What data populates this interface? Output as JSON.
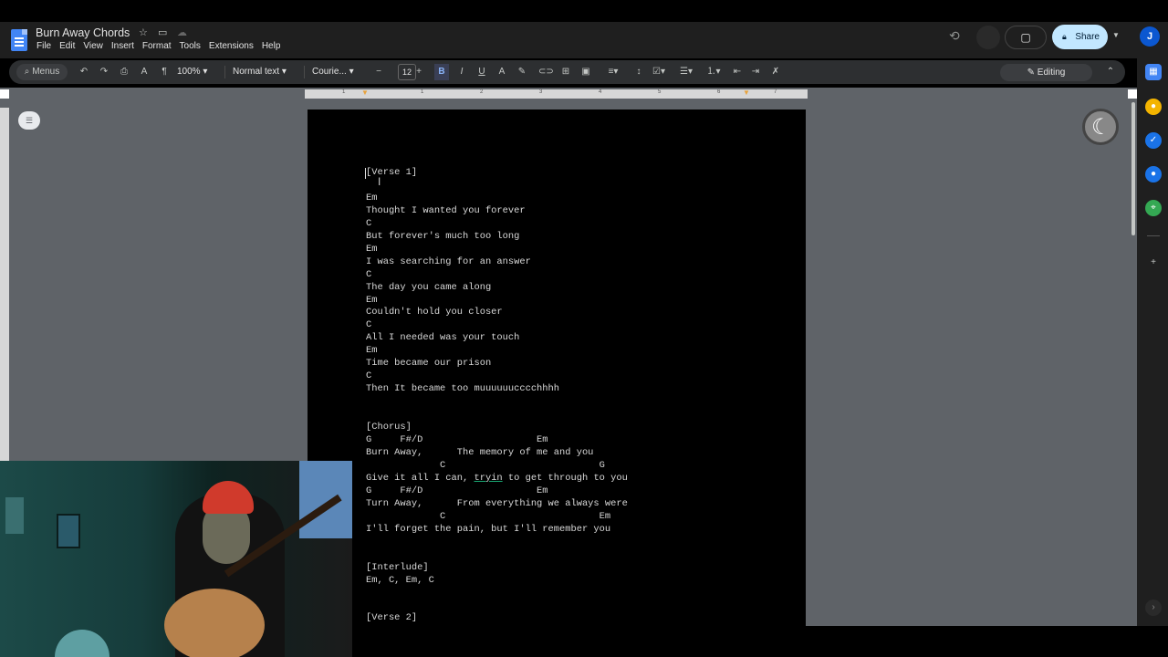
{
  "app": {
    "doc_title": "Burn Away Chords",
    "menu": [
      "File",
      "Edit",
      "View",
      "Insert",
      "Format",
      "Tools",
      "Extensions",
      "Help"
    ],
    "share_label": "Share",
    "avatar_letter": "J"
  },
  "toolbar": {
    "menus_label": "Menus",
    "zoom": "100%",
    "style": "Normal text",
    "font": "Courie...",
    "font_size": "12",
    "mode_label": "Editing"
  },
  "ruler": {
    "numbers": [
      "1",
      "1",
      "2",
      "3",
      "4",
      "5",
      "6",
      "7"
    ]
  },
  "document": {
    "lyrics": "[Verse 1]\n\nEm\nThought I wanted you forever\nC\nBut forever's much too long\nEm\nI was searching for an answer\nC\nThe day you came along\nEm\nCouldn't hold you closer\nC\nAll I needed was your touch\nEm\nTime became our prison\nC\nThen It became too muuuuuucccchhhh\n\n\n[Chorus]\nG     F#/D                    Em\nBurn Away,      The memory of me and you\n             C                           G\nGive it all I can, tryin to get through to you\nG     F#/D                    Em\nTurn Away,      From everything we always were\n             C                           Em\nI'll forget the pain, but I'll remember you\n\n\n[Interlude]\nEm, C, Em, C\n\n\n[Verse 2]"
  },
  "icons": {
    "star": "star-icon",
    "folder": "move-folder-icon",
    "cloud": "cloud-saved-icon"
  },
  "colors": {
    "share_bg": "#c2e7ff",
    "docs_blue": "#4285f4",
    "avatar_bg": "#0b57d0"
  }
}
